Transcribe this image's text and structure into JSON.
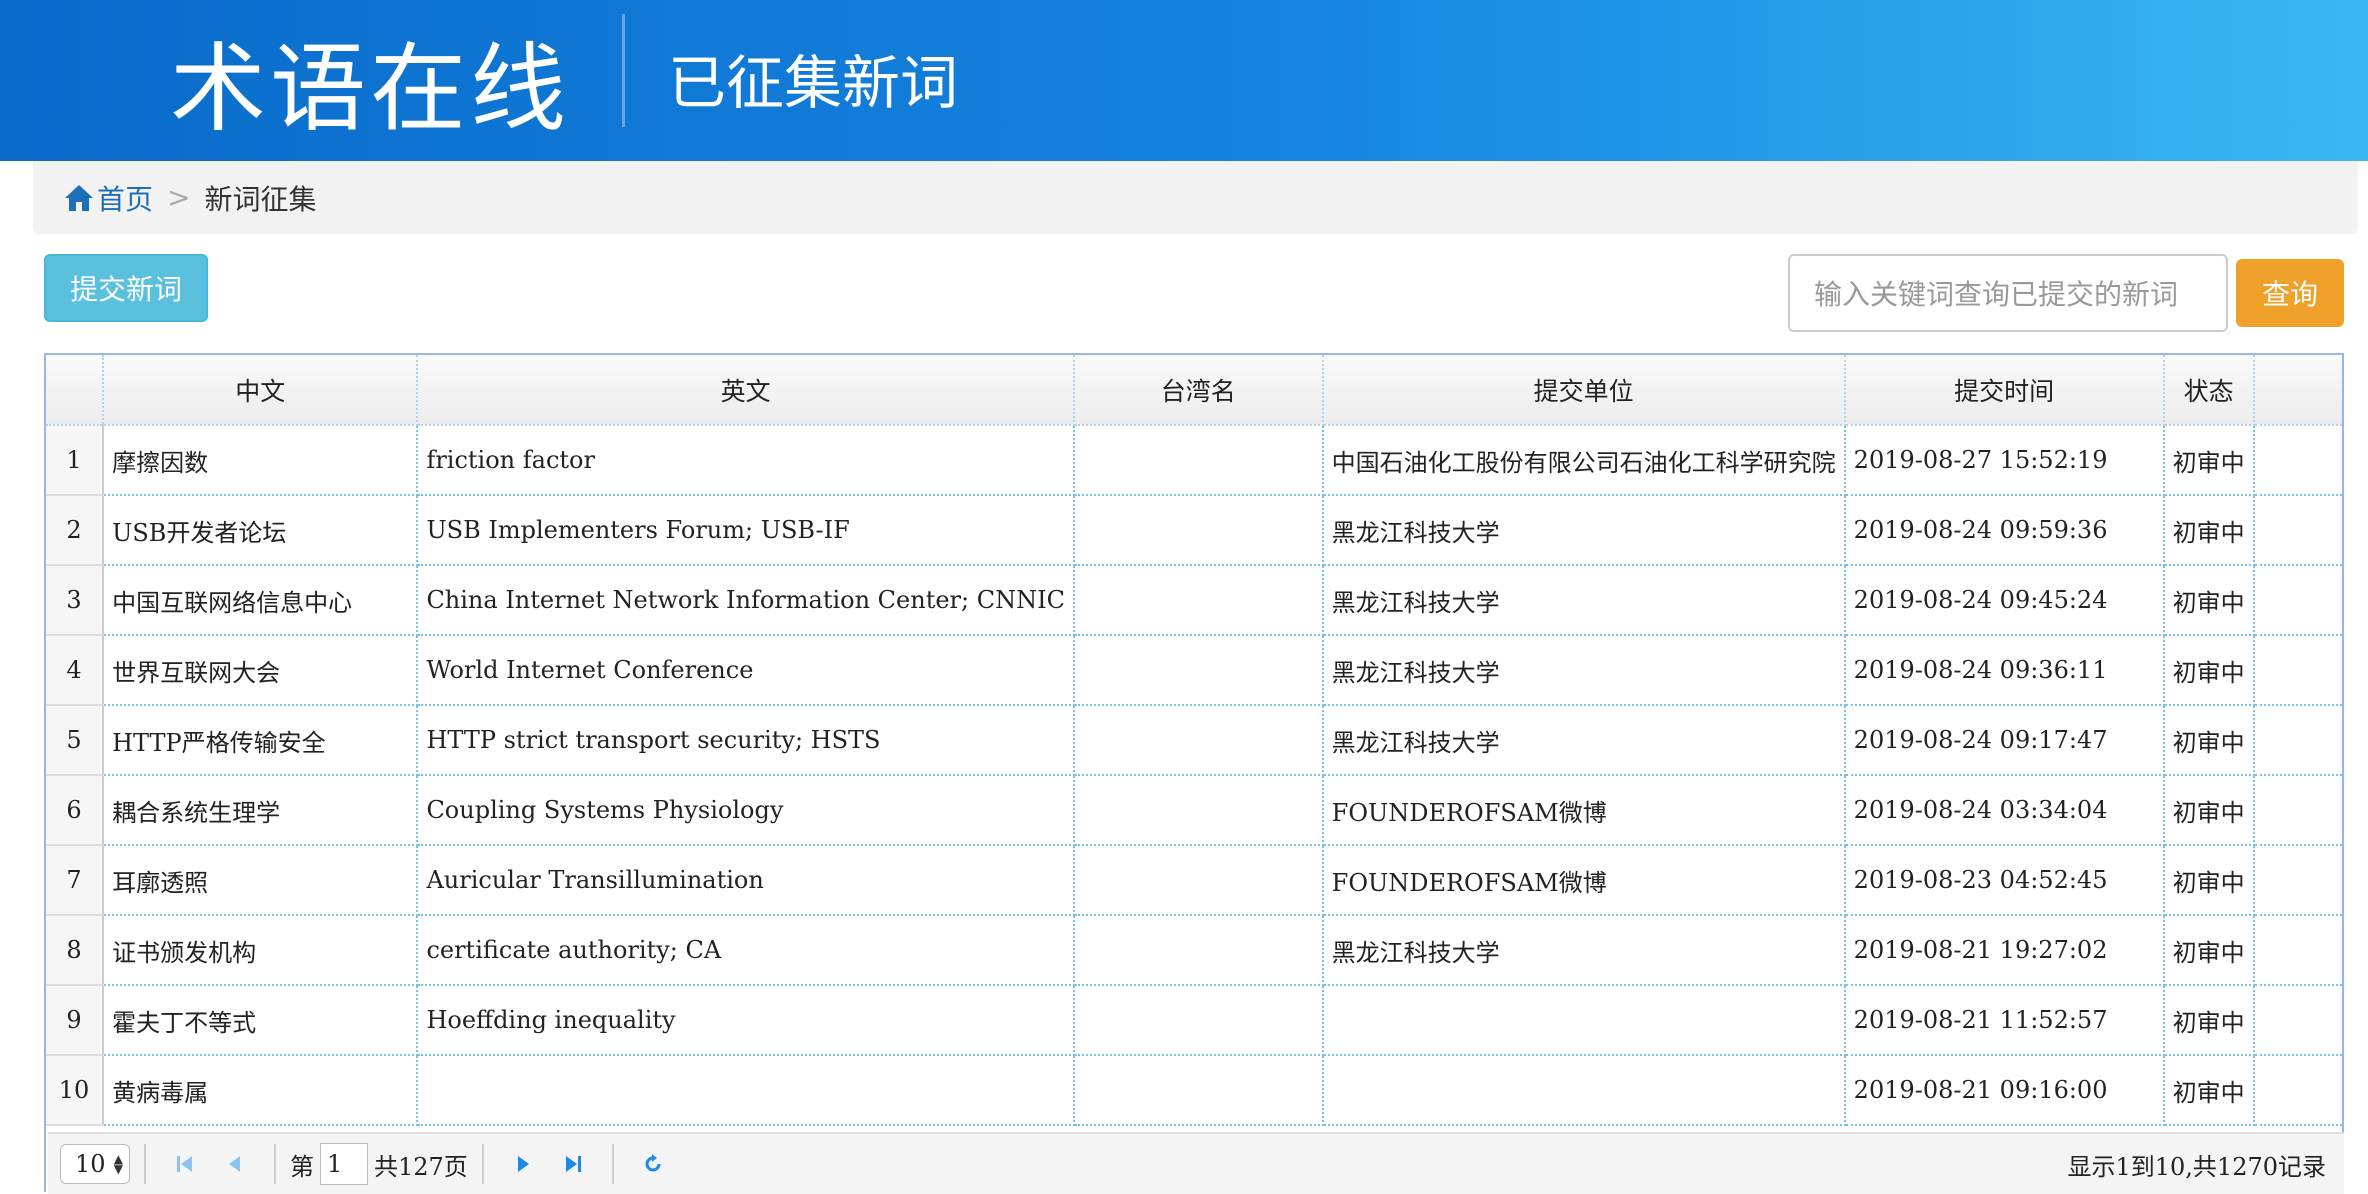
{
  "header": {
    "logo_text": "术语在线",
    "title": "已征集新词"
  },
  "breadcrumb": {
    "home": "首页",
    "separator": ">",
    "current": "新词征集"
  },
  "toolbar": {
    "submit_label": "提交新词",
    "search_placeholder": "输入关键词查询已提交的新词",
    "search_label": "查询"
  },
  "table": {
    "columns": [
      "中文",
      "英文",
      "台湾名",
      "提交单位",
      "提交时间",
      "状态"
    ],
    "rows": [
      {
        "n": "1",
        "zh": "摩擦因数",
        "en": "friction factor",
        "tw": "",
        "unit": "中国石油化工股份有限公司石油化工科学研究院",
        "time": "2019-08-27 15:52:19",
        "status": "初审中"
      },
      {
        "n": "2",
        "zh": "USB开发者论坛",
        "en": "USB Implementers Forum; USB-IF",
        "tw": "",
        "unit": "黑龙江科技大学",
        "time": "2019-08-24 09:59:36",
        "status": "初审中"
      },
      {
        "n": "3",
        "zh": "中国互联网络信息中心",
        "en": "China Internet Network Information Center; CNNIC",
        "tw": "",
        "unit": "黑龙江科技大学",
        "time": "2019-08-24 09:45:24",
        "status": "初审中"
      },
      {
        "n": "4",
        "zh": "世界互联网大会",
        "en": "World Internet Conference",
        "tw": "",
        "unit": "黑龙江科技大学",
        "time": "2019-08-24 09:36:11",
        "status": "初审中"
      },
      {
        "n": "5",
        "zh": "HTTP严格传输安全",
        "en": "HTTP strict transport security; HSTS",
        "tw": "",
        "unit": "黑龙江科技大学",
        "time": "2019-08-24 09:17:47",
        "status": "初审中"
      },
      {
        "n": "6",
        "zh": "耦合系统生理学",
        "en": "Coupling Systems Physiology",
        "tw": "",
        "unit": "FOUNDEROFSAM微博",
        "time": "2019-08-24 03:34:04",
        "status": "初审中"
      },
      {
        "n": "7",
        "zh": "耳廓透照",
        "en": "Auricular Transillumination",
        "tw": "",
        "unit": "FOUNDEROFSAM微博",
        "time": "2019-08-23 04:52:45",
        "status": "初审中"
      },
      {
        "n": "8",
        "zh": "证书颁发机构",
        "en": "certificate authority; CA",
        "tw": "",
        "unit": "黑龙江科技大学",
        "time": "2019-08-21 19:27:02",
        "status": "初审中"
      },
      {
        "n": "9",
        "zh": "霍夫丁不等式",
        "en": "Hoeffding inequality",
        "tw": "",
        "unit": "",
        "time": "2019-08-21 11:52:57",
        "status": "初审中"
      },
      {
        "n": "10",
        "zh": "黄病毒属",
        "en": "",
        "tw": "",
        "unit": "",
        "time": "2019-08-21 09:16:00",
        "status": "初审中"
      }
    ]
  },
  "pager": {
    "page_size": "10",
    "page_prefix": "第",
    "current_page": "1",
    "total_pages": "共127页",
    "info": "显示1到10,共1270记录"
  },
  "icons": {
    "home": "home-icon",
    "first": "first-page-icon",
    "prev": "prev-page-icon",
    "next": "next-page-icon",
    "last": "last-page-icon",
    "refresh": "refresh-icon"
  },
  "colors": {
    "header_start": "#0a6bc9",
    "header_end": "#3ab8f2",
    "submit": "#5bc0de",
    "search": "#f0a12a",
    "pager_icon": "#1e8ae6"
  }
}
